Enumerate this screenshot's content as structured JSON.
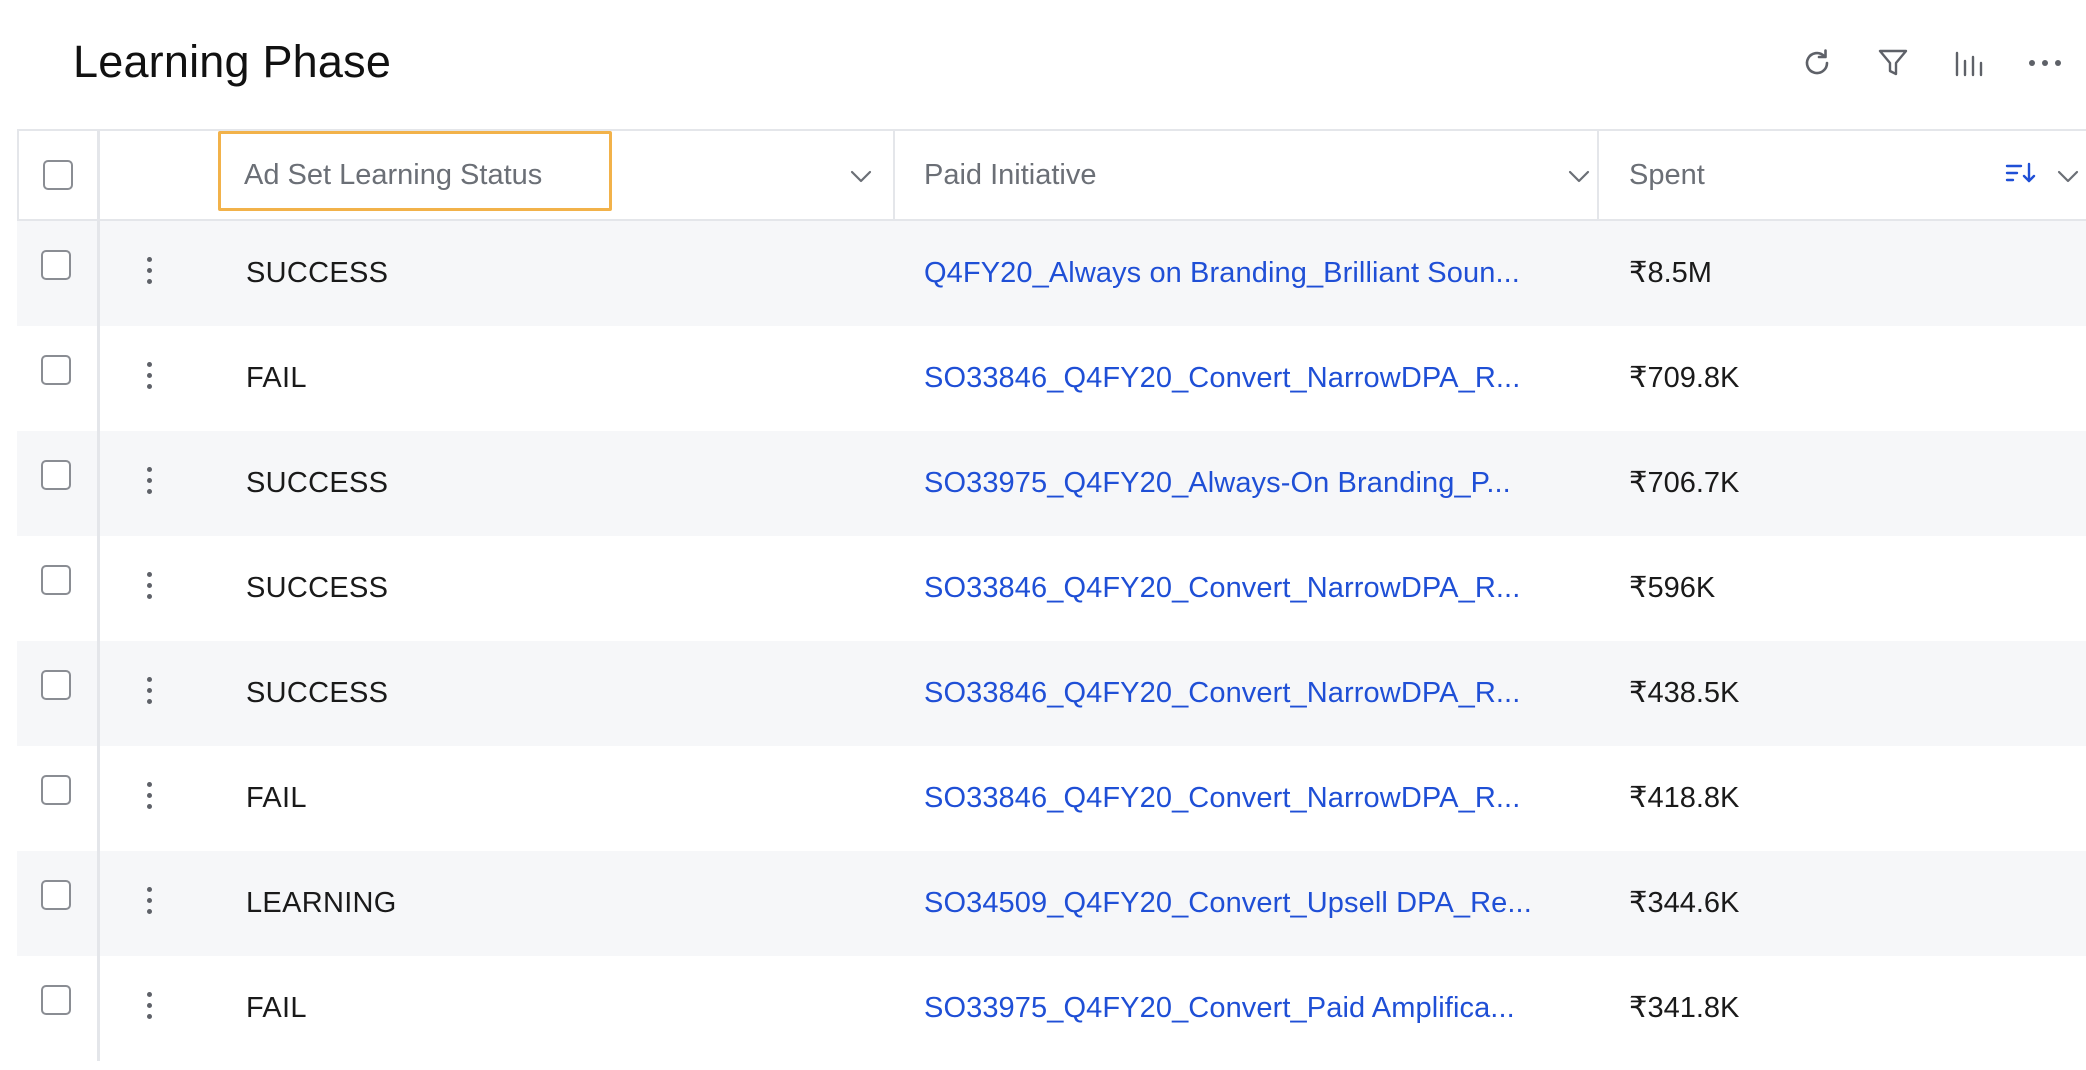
{
  "page": {
    "title": "Learning Phase"
  },
  "toolbar": {
    "icons": [
      "refresh-icon",
      "filter-icon",
      "columns-icon",
      "more-icon"
    ]
  },
  "table": {
    "columns": [
      {
        "label": "Ad Set Learning Status",
        "highlighted": true
      },
      {
        "label": "Paid Initiative"
      },
      {
        "label": "Spent",
        "sorted": "descending"
      }
    ],
    "rows": [
      {
        "status": "SUCCESS",
        "initiative": "Q4FY20_Always on Branding_Brilliant Soun...",
        "spent": "₹8.5M"
      },
      {
        "status": "FAIL",
        "initiative": "SO33846_Q4FY20_Convert_NarrowDPA_R...",
        "spent": "₹709.8K"
      },
      {
        "status": "SUCCESS",
        "initiative": "SO33975_Q4FY20_Always-On Branding_P...",
        "spent": "₹706.7K"
      },
      {
        "status": "SUCCESS",
        "initiative": "SO33846_Q4FY20_Convert_NarrowDPA_R...",
        "spent": "₹596K"
      },
      {
        "status": "SUCCESS",
        "initiative": "SO33846_Q4FY20_Convert_NarrowDPA_R...",
        "spent": "₹438.5K"
      },
      {
        "status": "FAIL",
        "initiative": "SO33846_Q4FY20_Convert_NarrowDPA_R...",
        "spent": "₹418.8K"
      },
      {
        "status": "LEARNING",
        "initiative": "SO34509_Q4FY20_Convert_Upsell DPA_Re...",
        "spent": "₹344.6K"
      },
      {
        "status": "FAIL",
        "initiative": "SO33975_Q4FY20_Convert_Paid Amplifica...",
        "spent": "₹341.8K"
      }
    ]
  },
  "colors": {
    "link": "#1f4fd6",
    "highlight_border": "#f2b24a",
    "stripe": "#f6f7f9",
    "border": "#e4e6ea"
  }
}
